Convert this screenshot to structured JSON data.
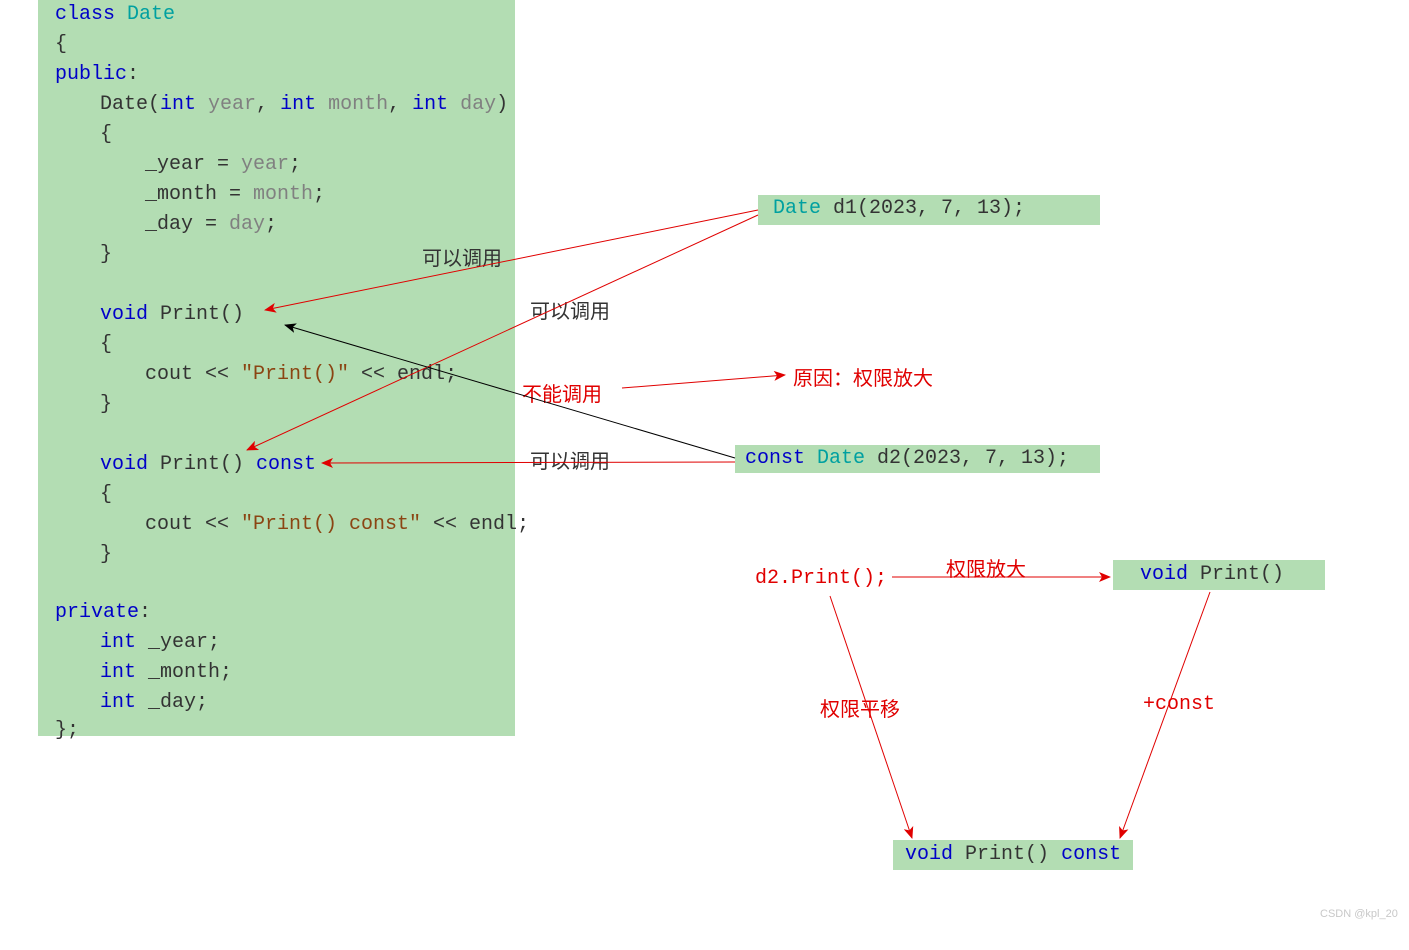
{
  "code": {
    "l1a": "class",
    "l1b": "Date",
    "l2": "{",
    "l3": "public",
    "l3b": ":",
    "l4a": "Date(",
    "l4b": "int ",
    "l4c": "year",
    "l4d": ", ",
    "l4e": "int ",
    "l4f": "month",
    "l4g": ", ",
    "l4h": "int ",
    "l4i": "day",
    "l4j": ")",
    "l5": "{",
    "l6a": "_year = ",
    "l6b": "year",
    "l6c": ";",
    "l7a": "_month = ",
    "l7b": "month",
    "l7c": ";",
    "l8a": "_day = ",
    "l8b": "day",
    "l8c": ";",
    "l9": "}",
    "l10a": "void",
    "l10b": " Print()",
    "l11": "{",
    "l12a": "cout << ",
    "l12b": "\"Print()\"",
    "l12c": " << endl;",
    "l13": "}",
    "l14a": "void",
    "l14b": " Print() ",
    "l14c": "const",
    "l15": "{",
    "l16a": "cout << ",
    "l16b": "\"Print() const\"",
    "l16c": " << endl;",
    "l17": "}",
    "l18": "private",
    "l18b": ":",
    "l19a": "int",
    "l19b": " _year;",
    "l20a": "int",
    "l20b": " _month;",
    "l21a": "int",
    "l21b": " _day;",
    "l22": "};"
  },
  "right": {
    "d1a": "Date ",
    "d1b": "d1(2023, 7, 13);",
    "d2a": "const ",
    "d2b": "Date ",
    "d2c": "d2(2023, 7, 13);",
    "d2print": "d2.Print();",
    "voidPrint_a": "void",
    "voidPrint_b": "Print()",
    "voidPrintConst_a": "void",
    "voidPrintConst_b": "Print()",
    "voidPrintConst_c": "const"
  },
  "ann": {
    "canCall": "可以调用",
    "cannotCall": "不能调用",
    "reason": "原因：权限放大",
    "permUp": "权限放大",
    "permLevel": "权限平移",
    "plusConst": "+const"
  },
  "watermark": "CSDN @kpl_20"
}
